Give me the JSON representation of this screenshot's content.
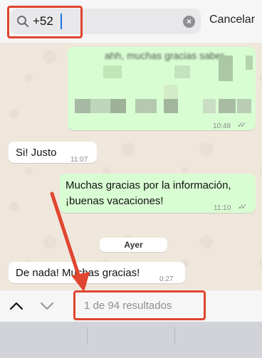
{
  "search": {
    "query": "+52",
    "cancel_label": "Cancelar",
    "clear_symbol": "×"
  },
  "messages": [
    {
      "direction": "outgoing",
      "text_line1": "",
      "text_line2": "",
      "time": "10:48",
      "status": "read",
      "blurred": true,
      "partial_text": "ahh, muchas gracias saber"
    },
    {
      "direction": "incoming",
      "text_line1": "Si! Justo",
      "time": "11:07"
    },
    {
      "direction": "outgoing",
      "text_line1": "Muchas gracias por la información,",
      "text_line2": "¡buenas vacaciones!",
      "time": "11:10",
      "status": "read"
    },
    {
      "direction": "incoming",
      "text_line1": "De nada! Muchas gracias!",
      "time": "0:27"
    }
  ],
  "day_separator": "Ayer",
  "nav": {
    "results": "1 de 94 resultados"
  },
  "colors": {
    "outgoing_bubble": "#d9fdd3",
    "incoming_bubble": "#ffffff",
    "annotation_red": "#e0452f",
    "read_ticks": "#8a8a8a"
  }
}
